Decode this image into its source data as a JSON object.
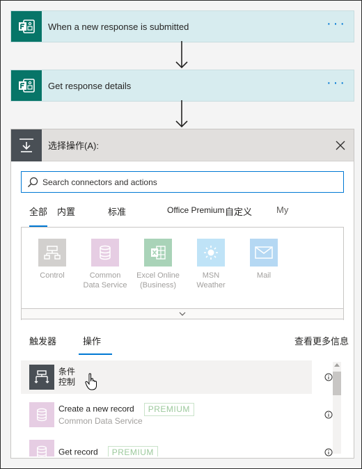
{
  "steps": [
    {
      "label": "When a new response is submitted"
    },
    {
      "label": "Get response details"
    }
  ],
  "more_label": "···",
  "panel": {
    "title": "选择操作(A):",
    "search_placeholder": "Search connectors and actions",
    "tabs": [
      "全部",
      "内置",
      "标准",
      "Office Premium",
      "自定义",
      "My"
    ],
    "connectors": [
      {
        "name_line1": "Control",
        "name_line2": "",
        "icon": "control-icon",
        "color": "#d2d0ce"
      },
      {
        "name_line1": "Common",
        "name_line2": "Data Service",
        "icon": "database-icon",
        "color": "#e6cde3"
      },
      {
        "name_line1": "Excel Online",
        "name_line2": "(Business)",
        "icon": "excel-icon",
        "color": "#a9d3b8"
      },
      {
        "name_line1": "MSN",
        "name_line2": "Weather",
        "icon": "weather-icon",
        "color": "#bfe3f7"
      },
      {
        "name_line1": "Mail",
        "name_line2": "",
        "icon": "mail-icon",
        "color": "#b5d8f3"
      }
    ],
    "subtabs": {
      "triggers": "触发器",
      "actions": "操作",
      "learn_more": "查看更多信息"
    },
    "actions": [
      {
        "title": "条件",
        "subtitle": "控制",
        "premium": ""
      },
      {
        "title": "Create a new record",
        "subtitle": "Common Data Service",
        "premium": "PREMIUM"
      },
      {
        "title": "Get record",
        "subtitle": "",
        "premium": "PREMIUM"
      }
    ]
  },
  "colors": {
    "accent": "#0078d4",
    "forms_tile": "#077568",
    "control_tile": "#494f55"
  }
}
